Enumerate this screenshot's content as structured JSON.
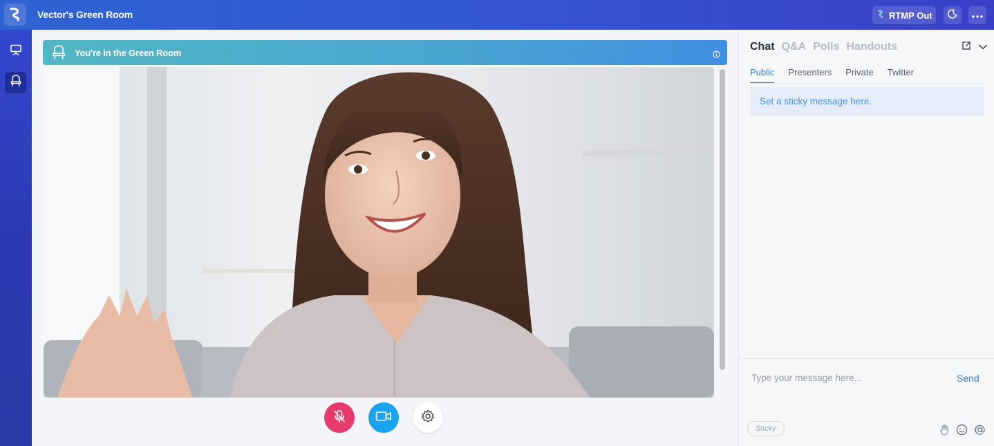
{
  "app": {
    "room_title": "Vector's Green Room",
    "logo_icon": "vector-logo-icon"
  },
  "header": {
    "rtmp_label": "RTMP Out",
    "icons": [
      "rtmp-icon",
      "moon-icon",
      "more-icon"
    ]
  },
  "sidebar": {
    "items": [
      {
        "icon": "presentation-icon",
        "active": false
      },
      {
        "icon": "green-room-icon",
        "active": true
      }
    ]
  },
  "stage": {
    "banner_text": "You're in the Green Room",
    "banner_icons": [
      "green-room-icon",
      "info-icon"
    ],
    "controls": [
      {
        "icon": "mic-off-icon",
        "color": "#e73a6f"
      },
      {
        "icon": "camera-icon",
        "color": "#1aa3ee"
      },
      {
        "icon": "gear-icon",
        "color": "#ffffff"
      }
    ]
  },
  "chat": {
    "tabs": [
      "Chat",
      "Q&A",
      "Polls",
      "Handouts"
    ],
    "active_tab": "Chat",
    "subtabs": [
      "Public",
      "Presenters",
      "Private",
      "Twitter"
    ],
    "active_subtab": "Public",
    "sticky_placeholder": "Set a sticky message here.",
    "input_placeholder": "Type your message here...",
    "send_label": "Send",
    "sticky_label": "Sticky",
    "tool_icons": [
      "hand-icon",
      "emoji-icon",
      "mention-icon"
    ]
  },
  "colors": {
    "accent": "#2e7ad9",
    "topbar": "#3456d4",
    "mic": "#e73a6f",
    "camera": "#1aa3ee"
  }
}
